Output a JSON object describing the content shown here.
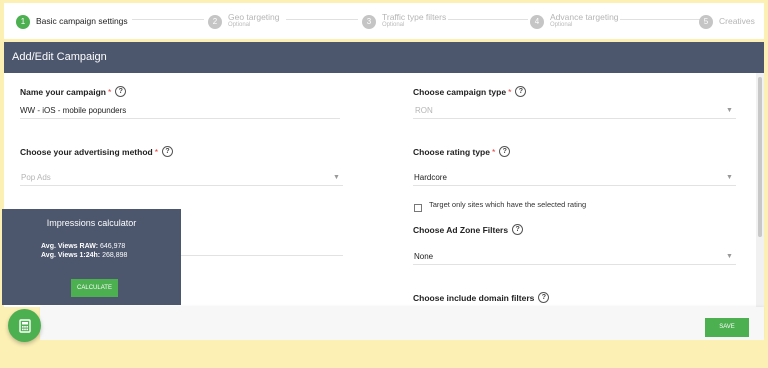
{
  "stepper": {
    "steps": [
      {
        "num": "1",
        "title": "Basic campaign settings",
        "sub": ""
      },
      {
        "num": "2",
        "title": "Geo targeting",
        "sub": "Optional"
      },
      {
        "num": "3",
        "title": "Traffic type filters",
        "sub": "Optional"
      },
      {
        "num": "4",
        "title": "Advance targeting",
        "sub": "Optional"
      },
      {
        "num": "5",
        "title": "Creatives",
        "sub": ""
      }
    ]
  },
  "panel": {
    "title": "Add/Edit Campaign"
  },
  "form": {
    "name": {
      "label": "Name your campaign",
      "required": "*",
      "value": "WW - iOS - mobile popunders"
    },
    "campaign_type": {
      "label": "Choose campaign type",
      "required": "*",
      "value": "RON"
    },
    "ad_method": {
      "label": "Choose your advertising method",
      "required": "*",
      "value": "Pop Ads"
    },
    "rating_type": {
      "label": "Choose rating type",
      "required": "*",
      "value": "Hardcore"
    },
    "target_only": {
      "label": "Target only sites which have the selected rating",
      "checked": false
    },
    "ad_zone": {
      "label": "Choose Ad Zone Filters",
      "value": "None"
    },
    "domain_filters": {
      "label": "Choose include domain filters"
    }
  },
  "calculator": {
    "title": "Impressions calculator",
    "raw_label": "Avg. Views RAW:",
    "raw_value": "646,978",
    "day_label": "Avg. Views 1:24h:",
    "day_value": "268,898",
    "button": "CALCULATE"
  },
  "actions": {
    "save": "SAVE"
  },
  "icons": {
    "help": "help-circle-icon",
    "caret": "caret-down-icon",
    "fab": "calculator-icon"
  },
  "colors": {
    "accent": "#4caf50",
    "header": "#4c566d",
    "background": "#fdf0b5"
  }
}
